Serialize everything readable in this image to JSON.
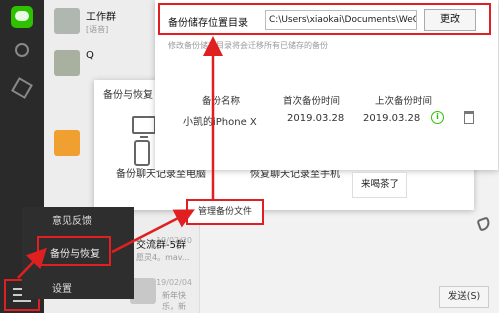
{
  "chat_list": [
    {
      "title": "工作群",
      "sub": "[语音]",
      "time": ""
    },
    {
      "title": "Q",
      "sub": "",
      "time": ""
    },
    {
      "title": "",
      "sub": "",
      "time": ""
    },
    {
      "title": "交流群-5群",
      "sub": "愿灵4。mav...",
      "time": "19/02/20"
    },
    {
      "title": "",
      "sub": "新年快乐，新春…",
      "time": "19/02/04"
    }
  ],
  "backup_dialog": {
    "title": "备份与恢复",
    "backup_to_pc": "备份聊天记录至电脑",
    "restore_to_phone": "恢复聊天记录至手机"
  },
  "settings": {
    "location_label": "备份储存位置目录",
    "location_path": "C:\\Users\\xiaokai\\Documents\\WeChat",
    "change_button": "更改",
    "location_desc": "修改备份储存目录将会迁移所有已储存的备份",
    "columns": [
      "备份名称",
      "首次备份时间",
      "上次备份时间"
    ],
    "row": {
      "name": "小凯的iPhone X",
      "first": "2019.03.28",
      "last": "2019.03.28"
    }
  },
  "manage_button": "管理备份文件",
  "menu": {
    "feedback": "意见反馈",
    "backup": "备份与恢复",
    "settings": "设置"
  },
  "chat": {
    "bubble": "来喝茶了",
    "send_button": "发送(S)"
  },
  "colors": {
    "highlight": "#e02020",
    "wechat_green": "#2dc100"
  }
}
